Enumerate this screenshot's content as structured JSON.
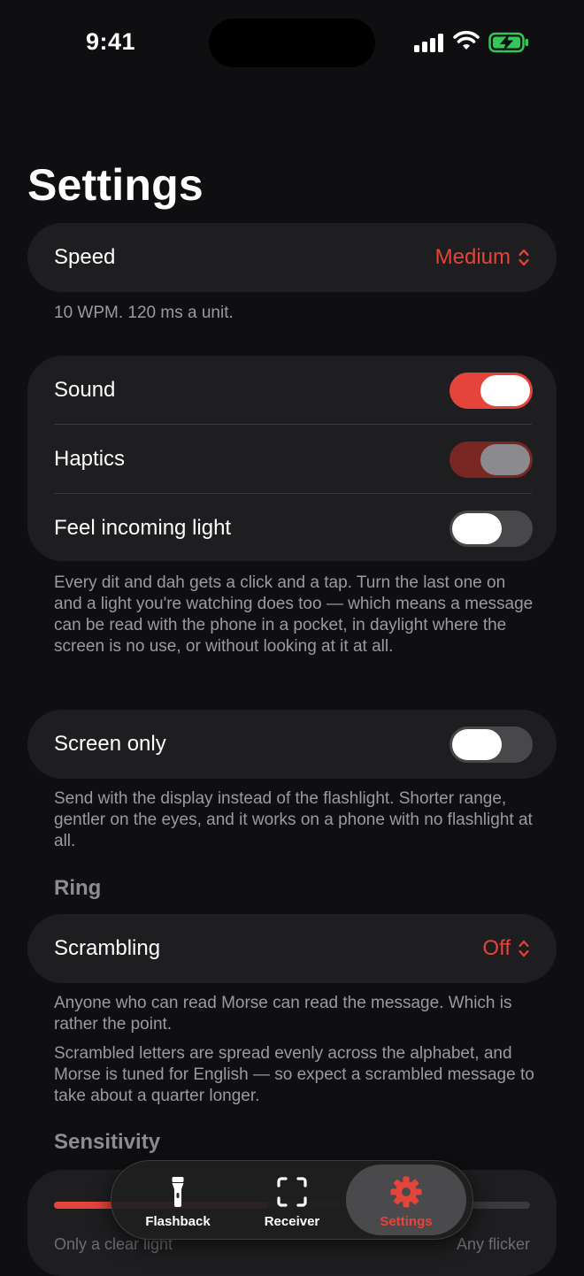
{
  "status_bar": {
    "time": "9:41"
  },
  "page": {
    "title": "Settings"
  },
  "speed": {
    "label": "Speed",
    "value": "Medium",
    "footnote": "10 WPM. 120 ms a unit."
  },
  "feedback": {
    "sound": {
      "label": "Sound",
      "on": true
    },
    "haptics": {
      "label": "Haptics",
      "on": true,
      "disabled": true
    },
    "feel_light": {
      "label": "Feel incoming light",
      "on": false
    },
    "footnote": "Every dit and dah gets a click and a tap. Turn the last one on and a light you're watching does too — which means a message can be read with the phone in a pocket, in daylight where the screen is no use, or without looking at it at all."
  },
  "screen_only": {
    "label": "Screen only",
    "on": false,
    "footnote": "Send with the display instead of the flashlight. Shorter range, gentler on the eyes, and it works on a phone with no flashlight at all."
  },
  "ring": {
    "header": "Ring",
    "scrambling_label": "Scrambling",
    "scrambling_value": "Off",
    "footnote_1": "Anyone who can read Morse can read the message. Which is rather the point.",
    "footnote_2": "Scrambled letters are spread evenly across the alphabet, and Morse is tuned for English — so expect a scrambled message to take about a quarter longer."
  },
  "sensitivity": {
    "header": "Sensitivity",
    "min_label": "Only a clear light",
    "max_label": "Any flicker",
    "value": 0.45
  },
  "tabbar": {
    "tabs": [
      {
        "label": "Flashback",
        "icon": "flashlight-icon"
      },
      {
        "label": "Receiver",
        "icon": "viewfinder-icon"
      },
      {
        "label": "Settings",
        "icon": "gear-icon",
        "active": true
      }
    ]
  },
  "colors": {
    "accent": "#e5443a",
    "background": "#0f0f11",
    "card": "#1e1e20",
    "secondary_text": "#9a9a9f"
  }
}
